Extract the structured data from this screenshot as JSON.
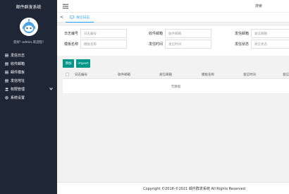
{
  "app": {
    "title": "邮件群发系统"
  },
  "user": {
    "greeting": "您好! admin,欢迎您!"
  },
  "menu": [
    {
      "label": "发信日志",
      "icon": "list-icon"
    },
    {
      "label": "收件邮箱",
      "icon": "list-icon"
    },
    {
      "label": "邮件模板",
      "icon": "list-icon"
    },
    {
      "label": "发信地址",
      "icon": "list-icon"
    },
    {
      "label": "权限管理",
      "icon": "users-icon",
      "has_submenu": true
    },
    {
      "label": "系统设置",
      "icon": "settings-icon"
    }
  ],
  "header": {
    "search_label": "搜索"
  },
  "tabs": {
    "back_symbol": "<",
    "active": "发信日志"
  },
  "filters": {
    "log_id": {
      "label": "日志编号",
      "placeholder": "日志编号"
    },
    "recipient": {
      "label": "收件邮箱",
      "placeholder": "收件邮箱"
    },
    "sender": {
      "label": "发信邮箱",
      "placeholder": "发信邮箱"
    },
    "template": {
      "label": "模板名称",
      "placeholder": "模板名称"
    },
    "send_time": {
      "label": "发信时间",
      "placeholder": "发信时间"
    },
    "status": {
      "label": "发信状态",
      "placeholder": "发信状态"
    }
  },
  "toolbar": {
    "add_label": "添加",
    "import_label": "import"
  },
  "table": {
    "columns": [
      "日志编号",
      "收件邮箱",
      "发信邮箱",
      "模板名称",
      "发信时间",
      "发信"
    ],
    "empty_text": "无数据"
  },
  "footer": {
    "copyright": "Copyright ©2016-©2021 邮件群发系统 All Rights Reserved"
  },
  "colors": {
    "sidebar": "#1f2736",
    "accent": "#009688",
    "tab_active": "#1e9fff"
  }
}
